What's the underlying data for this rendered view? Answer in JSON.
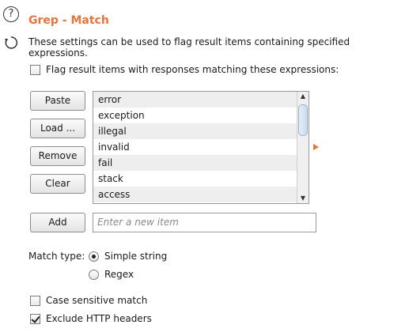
{
  "header": {
    "title": "Grep - Match",
    "description": "These settings can be used to flag result items containing specified expressions."
  },
  "flag_option": {
    "label": "Flag result items with responses matching these expressions:",
    "checked": false
  },
  "buttons": {
    "paste": "Paste",
    "load": "Load ...",
    "remove": "Remove",
    "clear": "Clear",
    "add": "Add"
  },
  "expressions": [
    "error",
    "exception",
    "illegal",
    "invalid",
    "fail",
    "stack",
    "access"
  ],
  "new_item": {
    "placeholder": "Enter a new item"
  },
  "match_type": {
    "label": "Match type:",
    "options": [
      {
        "label": "Simple string",
        "selected": true
      },
      {
        "label": "Regex",
        "selected": false
      }
    ]
  },
  "options": {
    "case_sensitive": {
      "label": "Case sensitive match",
      "checked": false
    },
    "exclude_headers": {
      "label": "Exclude HTTP headers",
      "checked": true
    }
  },
  "colors": {
    "accent": "#e8743a"
  }
}
